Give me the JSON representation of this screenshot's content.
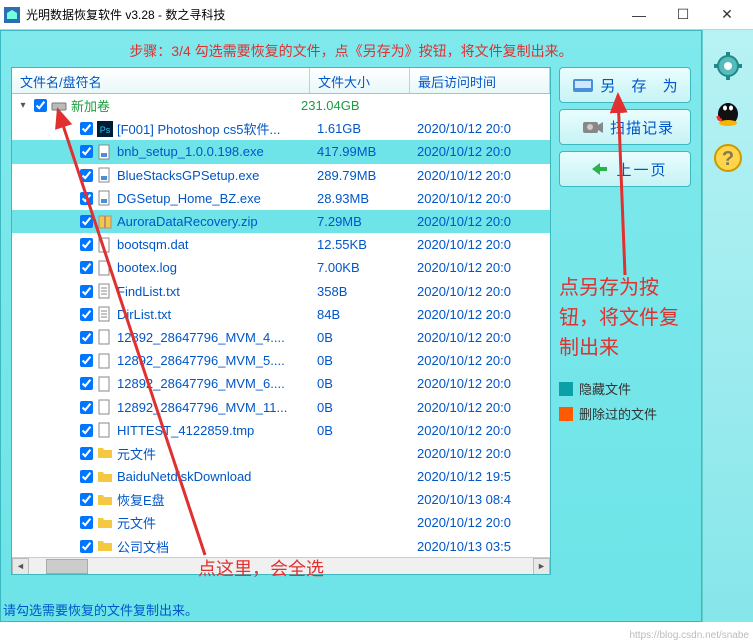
{
  "window": {
    "title": "光明数据恢复软件 v3.28 - 数之寻科技"
  },
  "banner": "步骤：3/4 勾选需要恢复的文件，点《另存为》按钮，将文件复制出来。",
  "columns": {
    "name": "文件名/盘符名",
    "size": "文件大小",
    "date": "最后访问时间"
  },
  "root": {
    "label": "新加卷",
    "size": "231.04GB"
  },
  "files": [
    {
      "name": "[F001] Photoshop cs5软件...",
      "size": "1.61GB",
      "date": "2020/10/12 20:0",
      "icon": "ps",
      "indent": 2
    },
    {
      "name": "bnb_setup_1.0.0.198.exe",
      "size": "417.99MB",
      "date": "2020/10/12 20:0",
      "icon": "exe",
      "indent": 2,
      "sel": true
    },
    {
      "name": "BlueStacksGPSetup.exe",
      "size": "289.79MB",
      "date": "2020/10/12 20:0",
      "icon": "exe",
      "indent": 2
    },
    {
      "name": "DGSetup_Home_BZ.exe",
      "size": "28.93MB",
      "date": "2020/10/12 20:0",
      "icon": "exe",
      "indent": 2
    },
    {
      "name": "AuroraDataRecovery.zip",
      "size": "7.29MB",
      "date": "2020/10/12 20:0",
      "icon": "zip",
      "indent": 2,
      "sel": true
    },
    {
      "name": "bootsqm.dat",
      "size": "12.55KB",
      "date": "2020/10/12 20:0",
      "icon": "file",
      "indent": 2
    },
    {
      "name": "bootex.log",
      "size": "7.00KB",
      "date": "2020/10/12 20:0",
      "icon": "file",
      "indent": 2
    },
    {
      "name": "FindList.txt",
      "size": "358B",
      "date": "2020/10/12 20:0",
      "icon": "txt",
      "indent": 2
    },
    {
      "name": "DirList.txt",
      "size": "84B",
      "date": "2020/10/12 20:0",
      "icon": "txt",
      "indent": 2
    },
    {
      "name": "12892_28647796_MVM_4....",
      "size": "0B",
      "date": "2020/10/12 20:0",
      "icon": "file",
      "indent": 2
    },
    {
      "name": "12892_28647796_MVM_5....",
      "size": "0B",
      "date": "2020/10/12 20:0",
      "icon": "file",
      "indent": 2
    },
    {
      "name": "12892_28647796_MVM_6....",
      "size": "0B",
      "date": "2020/10/12 20:0",
      "icon": "file",
      "indent": 2
    },
    {
      "name": "12892_28647796_MVM_11...",
      "size": "0B",
      "date": "2020/10/12 20:0",
      "icon": "file",
      "indent": 2
    },
    {
      "name": "HITTEST_4122859.tmp",
      "size": "0B",
      "date": "2020/10/12 20:0",
      "icon": "file",
      "indent": 2
    },
    {
      "name": "元文件",
      "size": "",
      "date": "2020/10/12 20:0",
      "icon": "folder",
      "indent": 2
    },
    {
      "name": "BaiduNetdiskDownload",
      "size": "",
      "date": "2020/10/12 19:5",
      "icon": "folder",
      "indent": 2
    },
    {
      "name": "恢复E盘",
      "size": "",
      "date": "2020/10/13 08:4",
      "icon": "folder",
      "indent": 2
    },
    {
      "name": "元文件",
      "size": "",
      "date": "2020/10/12 20:0",
      "icon": "folder",
      "indent": 2
    },
    {
      "name": "公司文档",
      "size": "",
      "date": "2020/10/13 03:5",
      "icon": "folder",
      "indent": 2
    }
  ],
  "buttons": {
    "saveas": "另 存 为",
    "scanlog": "扫描记录",
    "prev": "上一页"
  },
  "legend": {
    "hidden": "隐藏文件",
    "deleted": "删除过的文件"
  },
  "legend_colors": {
    "hidden": "#0aa0a5",
    "deleted": "#ff5a00"
  },
  "annotations": {
    "saveas": "点另存为按钮，将文件复制出来",
    "selectall": "点这里，会全选"
  },
  "footer": "请勾选需要恢复的文件复制出来。",
  "watermark": "https://blog.csdn.net/snabe"
}
